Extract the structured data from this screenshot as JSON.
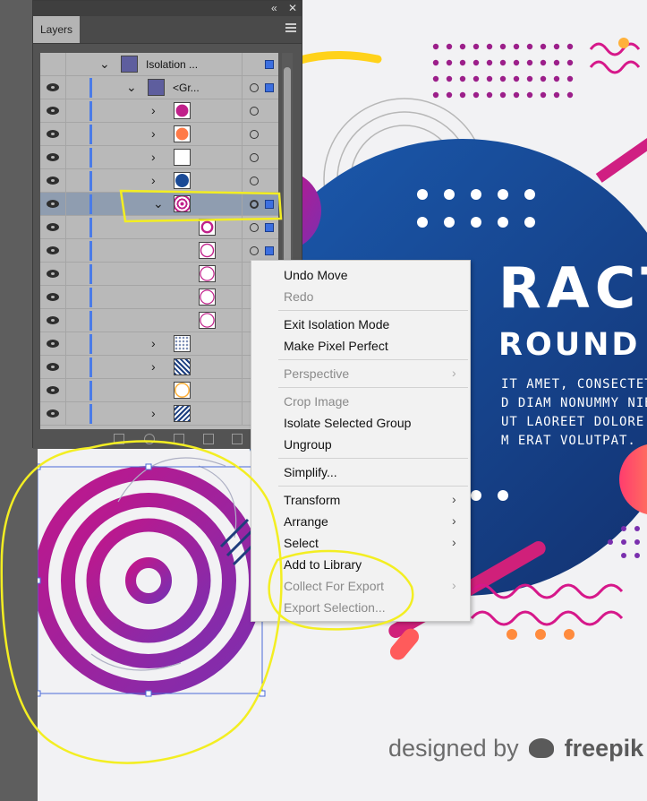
{
  "layers_panel": {
    "tab_label": "Layers",
    "collapse_glyph": "«",
    "close_glyph": "✕",
    "rows": [
      {
        "name": "Isolation ...",
        "indent": 0
      },
      {
        "name": "<Gr...",
        "indent": 1
      },
      {
        "name": "",
        "indent": 2
      },
      {
        "name": "",
        "indent": 2
      },
      {
        "name": "",
        "indent": 2
      },
      {
        "name": "",
        "indent": 2
      },
      {
        "name": "",
        "indent": 2,
        "selected": true
      },
      {
        "name": "",
        "indent": 3
      },
      {
        "name": "",
        "indent": 3
      },
      {
        "name": "",
        "indent": 3
      },
      {
        "name": "",
        "indent": 3
      },
      {
        "name": "",
        "indent": 3
      },
      {
        "name": "",
        "indent": 2
      },
      {
        "name": "",
        "indent": 2
      },
      {
        "name": "",
        "indent": 2
      },
      {
        "name": "",
        "indent": 2
      }
    ]
  },
  "context_menu": {
    "items": [
      {
        "label": "Undo Move",
        "enabled": true,
        "submenu": false
      },
      {
        "label": "Redo",
        "enabled": false,
        "submenu": false
      },
      {
        "label": "Exit Isolation Mode",
        "enabled": true,
        "submenu": false
      },
      {
        "label": "Make Pixel Perfect",
        "enabled": true,
        "submenu": false
      },
      {
        "label": "Perspective",
        "enabled": false,
        "submenu": true
      },
      {
        "label": "Crop Image",
        "enabled": false,
        "submenu": false
      },
      {
        "label": "Isolate Selected Group",
        "enabled": true,
        "submenu": false
      },
      {
        "label": "Ungroup",
        "enabled": true,
        "submenu": false
      },
      {
        "label": "Simplify...",
        "enabled": true,
        "submenu": false
      },
      {
        "label": "Transform",
        "enabled": true,
        "submenu": true
      },
      {
        "label": "Arrange",
        "enabled": true,
        "submenu": true
      },
      {
        "label": "Select",
        "enabled": true,
        "submenu": true
      },
      {
        "label": "Add to Library",
        "enabled": true,
        "submenu": false
      },
      {
        "label": "Collect For Export",
        "enabled": false,
        "submenu": true
      },
      {
        "label": "Export Selection...",
        "enabled": false,
        "submenu": false
      }
    ]
  },
  "artwork": {
    "title_text": "RACT",
    "subtitle_text": "ROUND",
    "body_lines": [
      "IT AMET, CONSECTETUER",
      "D DIAM NONUMMY NIBH",
      " UT LAOREET DOLORE",
      "M ERAT VOLUTPAT."
    ],
    "credit_prefix": "designed by",
    "credit_brand": "freepik"
  },
  "colors": {
    "accent_blue": "#1a4a96",
    "magenta": "#b0177e",
    "purple": "#7d2ba8",
    "yellow_annotation": "#f3ee22",
    "selection_blue": "#3c6fe0"
  }
}
